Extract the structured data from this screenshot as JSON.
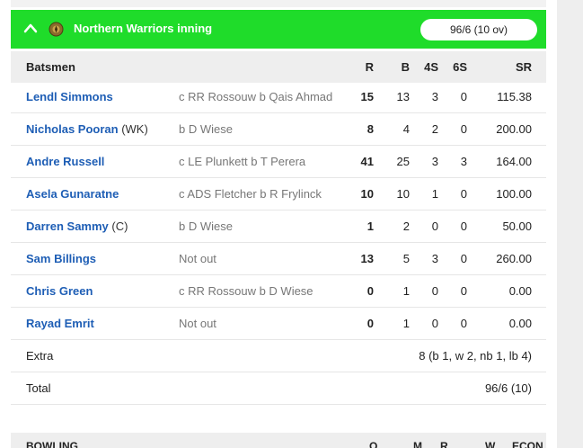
{
  "innings": {
    "team": "Northern Warriors inning",
    "score": "96/6 (10 ov)",
    "colors": {
      "header": "#1fdc2a",
      "link": "#1e5eb5"
    }
  },
  "columns": {
    "batsmen": "Batsmen",
    "r": "R",
    "b": "B",
    "fours": "4S",
    "sixes": "6S",
    "sr": "SR"
  },
  "batsmen": [
    {
      "name": "Lendl Simmons",
      "suffix": "",
      "dismissal": "c RR Rossouw b Qais Ahmad",
      "r": "15",
      "b": "13",
      "fours": "3",
      "sixes": "0",
      "sr": "115.38"
    },
    {
      "name": "Nicholas Pooran",
      "suffix": "(WK)",
      "dismissal": "b D Wiese",
      "r": "8",
      "b": "4",
      "fours": "2",
      "sixes": "0",
      "sr": "200.00"
    },
    {
      "name": "Andre Russell",
      "suffix": "",
      "dismissal": "c LE Plunkett b T Perera",
      "r": "41",
      "b": "25",
      "fours": "3",
      "sixes": "3",
      "sr": "164.00"
    },
    {
      "name": "Asela Gunaratne",
      "suffix": "",
      "dismissal": "c ADS Fletcher b R Frylinck",
      "r": "10",
      "b": "10",
      "fours": "1",
      "sixes": "0",
      "sr": "100.00"
    },
    {
      "name": "Darren Sammy",
      "suffix": "(C)",
      "dismissal": "b D Wiese",
      "r": "1",
      "b": "2",
      "fours": "0",
      "sixes": "0",
      "sr": "50.00"
    },
    {
      "name": "Sam Billings",
      "suffix": "",
      "dismissal": "Not out",
      "r": "13",
      "b": "5",
      "fours": "3",
      "sixes": "0",
      "sr": "260.00"
    },
    {
      "name": "Chris Green",
      "suffix": "",
      "dismissal": "c RR Rossouw b D Wiese",
      "r": "0",
      "b": "1",
      "fours": "0",
      "sixes": "0",
      "sr": "0.00"
    },
    {
      "name": "Rayad Emrit",
      "suffix": "",
      "dismissal": "Not out",
      "r": "0",
      "b": "1",
      "fours": "0",
      "sixes": "0",
      "sr": "0.00"
    }
  ],
  "extra": {
    "label": "Extra",
    "value": "8 (b 1, w 2, nb 1, lb 4)"
  },
  "total": {
    "label": "Total",
    "value": "96/6 (10)"
  },
  "bowling": {
    "title": "BOWLING",
    "o": "O",
    "m": "M",
    "r": "R",
    "w": "W",
    "econ": "ECON"
  }
}
